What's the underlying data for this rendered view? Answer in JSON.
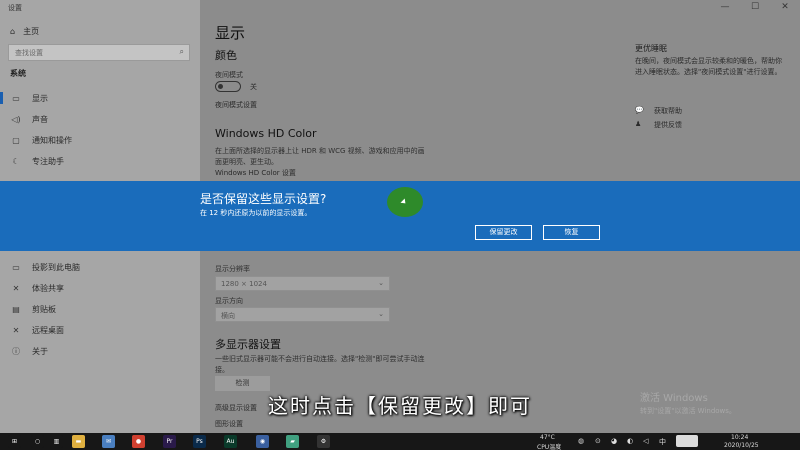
{
  "window": {
    "title": "设置",
    "controls": [
      "—",
      "☐",
      "✕"
    ]
  },
  "sidebar": {
    "home": "主页",
    "search_placeholder": "查找设置",
    "section": "系统",
    "items": [
      {
        "label": "显示",
        "icon": "monitor-icon",
        "glyph": "▭"
      },
      {
        "label": "声音",
        "icon": "speaker-icon",
        "glyph": "◁)"
      },
      {
        "label": "通知和操作",
        "icon": "notification-icon",
        "glyph": "▢"
      },
      {
        "label": "专注助手",
        "icon": "moon-icon",
        "glyph": "☾"
      },
      {
        "label": "投影到此电脑",
        "icon": "project-icon",
        "glyph": "▭"
      },
      {
        "label": "体验共享",
        "icon": "shared-icon",
        "glyph": "✕"
      },
      {
        "label": "剪贴板",
        "icon": "clipboard-icon",
        "glyph": "▤"
      },
      {
        "label": "远程桌面",
        "icon": "remote-icon",
        "glyph": "✕"
      },
      {
        "label": "关于",
        "icon": "info-icon",
        "glyph": "ⓘ"
      }
    ]
  },
  "main": {
    "title": "显示",
    "color_heading": "颜色",
    "night_mode_label": "夜间模式",
    "night_mode_state": "关",
    "night_mode_settings": "夜间模式设置",
    "hd_heading": "Windows HD Color",
    "hd_desc_1": "在上面所选择的显示器上让 HDR 和 WCG 视频、游戏和应用中的画",
    "hd_desc_2": "面更明亮、更生动。",
    "hd_settings": "Windows HD Color 设置",
    "resolution_label": "显示分辨率",
    "resolution_value": "1280 × 1024",
    "orientation_label": "显示方向",
    "orientation_value": "横向",
    "multi_heading": "多显示器设置",
    "multi_desc_1": "一些旧式显示器可能不会进行自动连接。选择\"检测\"即可尝试手动连",
    "multi_desc_2": "接。",
    "detect_button": "检测",
    "advanced_label": "高级显示设置",
    "graphics_label": "图形设置"
  },
  "right_panel": {
    "title": "更优睡眠",
    "text": "在晚间，夜间模式会显示较柔和的暖色，帮助你进入睡眠状态。选择\"夜间模式设置\"进行设置。",
    "help": "获取帮助",
    "feedback": "提供反馈"
  },
  "dialog": {
    "title": "是否保留这些显示设置?",
    "subtitle": "在 12 秒内还原为以前的显示设置。",
    "keep_button": "保留更改",
    "revert_button": "恢复"
  },
  "subtitle": "这时点击【保留更改】即可",
  "watermark": {
    "line1": "激活 Windows",
    "line2": "转到\"设置\"以激活 Windows。"
  },
  "taskbar": {
    "weather": "47°C",
    "cpu": "CPU温度",
    "time": "10:24",
    "date": "2020/10/25",
    "apps": [
      {
        "icon": "start-icon",
        "color": "#171717",
        "glyph": "⊞"
      },
      {
        "icon": "search-icon",
        "color": "#171717",
        "glyph": "○"
      },
      {
        "icon": "task-view-icon",
        "color": "#171717",
        "glyph": "▥"
      },
      {
        "icon": "file-explorer-icon",
        "color": "#e0b040",
        "glyph": "▬"
      },
      {
        "icon": "mail-icon",
        "color": "#4a7fc0",
        "glyph": "✉"
      },
      {
        "icon": "chrome-icon",
        "color": "#d04030",
        "glyph": "●"
      },
      {
        "icon": "premiere-icon",
        "color": "#2a1a4a",
        "glyph": "Pr"
      },
      {
        "icon": "photoshop-icon",
        "color": "#0a2a4a",
        "glyph": "Ps"
      },
      {
        "icon": "audition-icon",
        "color": "#0a3a2a",
        "glyph": "Au"
      },
      {
        "icon": "app-icon",
        "color": "#3a60a0",
        "glyph": "◉"
      },
      {
        "icon": "app2-icon",
        "color": "#40a080",
        "glyph": "▰"
      },
      {
        "icon": "settings-icon",
        "color": "#333333",
        "glyph": "⚙"
      }
    ]
  },
  "colors": {
    "banner": "#1a6cbb",
    "accent": "#1a5fb0"
  }
}
